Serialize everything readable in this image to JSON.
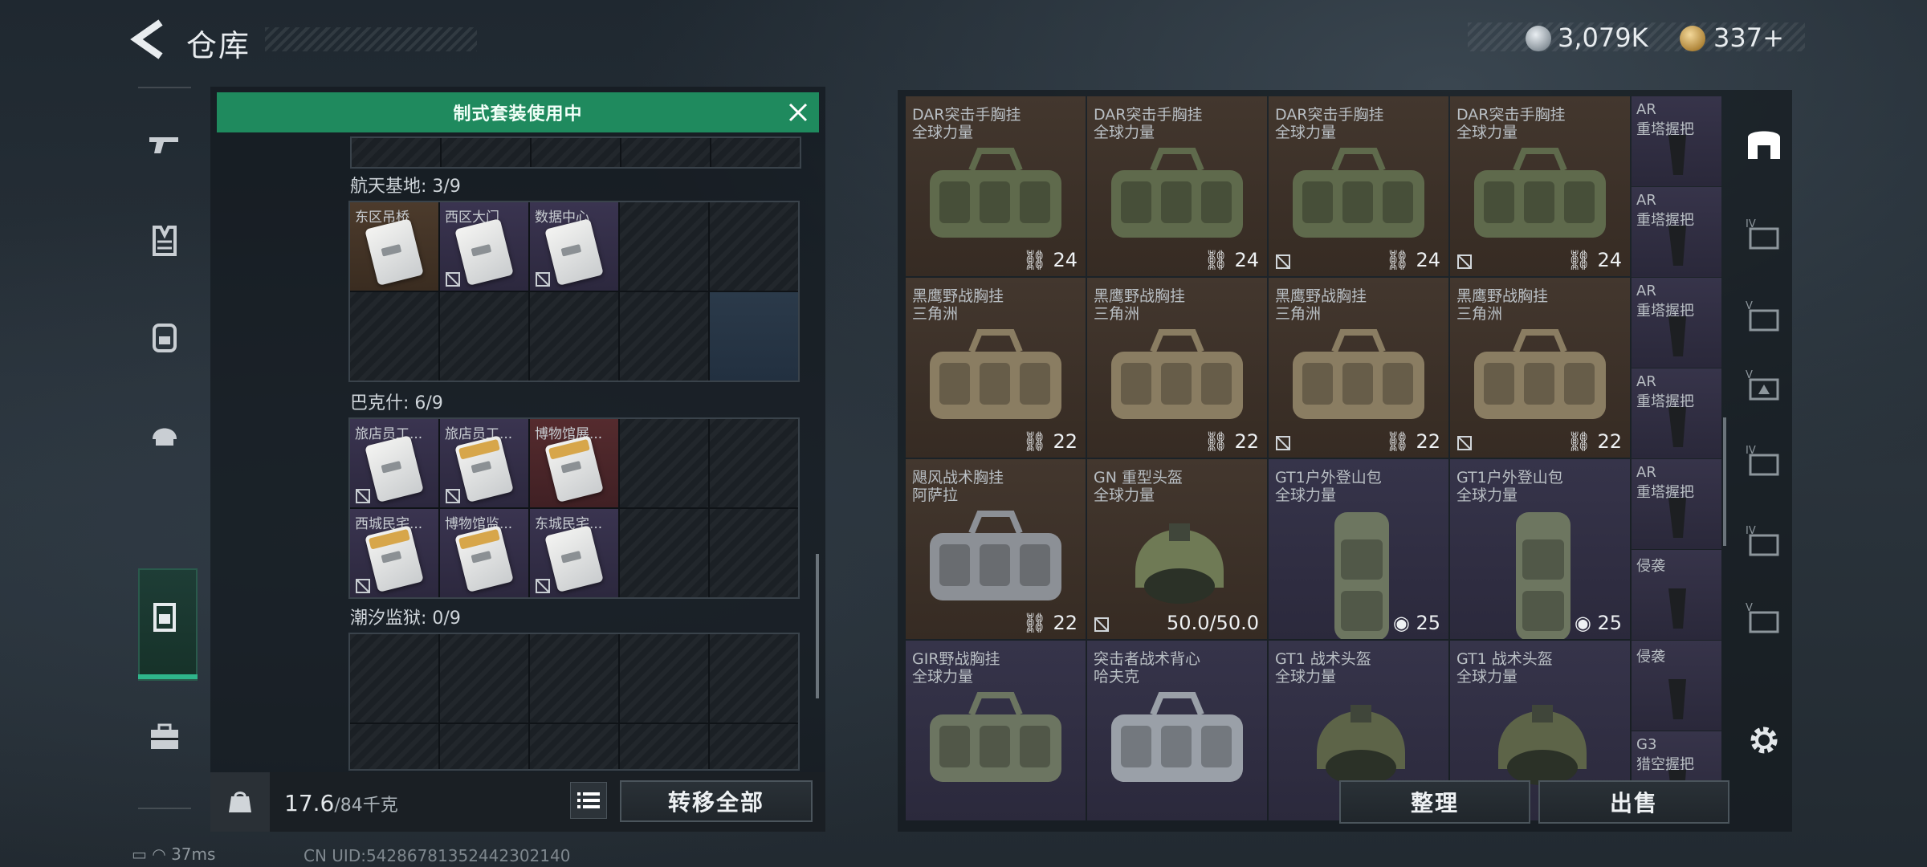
{
  "header": {
    "title": "仓库",
    "currency_silver": "3,079K",
    "currency_gold": "337+"
  },
  "banner": {
    "text": "制式套装使用中"
  },
  "sections": [
    {
      "label": "航天基地: 3/9",
      "cells": [
        "东区吊桥",
        "西区大门",
        "数据中心"
      ]
    },
    {
      "label": "巴克什: 6/9",
      "cells": [
        "旅店员工...",
        "旅店员工...",
        "博物馆展...",
        "西城民宅...",
        "博物馆监...",
        "东城民宅..."
      ]
    },
    {
      "label": "潮汐监狱: 0/9",
      "cells": []
    }
  ],
  "footer": {
    "weight": "17.6",
    "capacity": "/84千克",
    "transfer_all": "转移全部",
    "kg_label": "KG"
  },
  "items": [
    {
      "name": "DAR突击手胸挂",
      "brand": "全球力量",
      "value": "24",
      "color": "brown",
      "kind": "bag",
      "bagcolor": "#5f6a4c"
    },
    {
      "name": "DAR突击手胸挂",
      "brand": "全球力量",
      "value": "24",
      "color": "brown",
      "kind": "bag",
      "bagcolor": "#5f6a4c"
    },
    {
      "name": "DAR突击手胸挂",
      "brand": "全球力量",
      "value": "24",
      "color": "brown",
      "kind": "bag",
      "bagcolor": "#5f6a4c"
    },
    {
      "name": "DAR突击手胸挂",
      "brand": "全球力量",
      "value": "24",
      "color": "brown",
      "kind": "bag",
      "bagcolor": "#5f6a4c"
    },
    {
      "name": "黑鹰野战胸挂",
      "brand": "三角洲",
      "value": "22",
      "color": "brown",
      "kind": "bag",
      "bagcolor": "#8a7d62"
    },
    {
      "name": "黑鹰野战胸挂",
      "brand": "三角洲",
      "value": "22",
      "color": "brown",
      "kind": "bag",
      "bagcolor": "#8a7d62"
    },
    {
      "name": "黑鹰野战胸挂",
      "brand": "三角洲",
      "value": "22",
      "color": "brown",
      "kind": "bag",
      "bagcolor": "#8a7d62"
    },
    {
      "name": "黑鹰野战胸挂",
      "brand": "三角洲",
      "value": "22",
      "color": "brown",
      "kind": "bag",
      "bagcolor": "#8a7d62"
    },
    {
      "name": "飓风战术胸挂",
      "brand": "阿萨拉",
      "value": "22",
      "color": "brown",
      "kind": "bag",
      "bagcolor": "#8c9096"
    },
    {
      "name": "GN 重型头盔",
      "brand": "全球力量",
      "value": "50.0/50.0",
      "color": "brown",
      "kind": "helmet",
      "bagcolor": "#6f7a55"
    },
    {
      "name": "GT1户外登山包",
      "brand": "全球力量",
      "value": "25",
      "color": "purple",
      "kind": "pack",
      "bagcolor": "#6d7660"
    },
    {
      "name": "GT1户外登山包",
      "brand": "全球力量",
      "value": "25",
      "color": "purple",
      "kind": "pack",
      "bagcolor": "#6d7660"
    },
    {
      "name": "GIR野战胸挂",
      "brand": "全球力量",
      "value": "",
      "color": "purple",
      "kind": "bag",
      "bagcolor": "#6c7561"
    },
    {
      "name": "突击者战术背心",
      "brand": "哈夫克",
      "value": "",
      "color": "purple",
      "kind": "bag",
      "bagcolor": "#9aa0a8"
    },
    {
      "name": "GT1 战术头盔",
      "brand": "全球力量",
      "value": "",
      "color": "purple",
      "kind": "helmet",
      "bagcolor": "#5d6448"
    },
    {
      "name": "GT1 战术头盔",
      "brand": "全球力量",
      "value": "",
      "color": "purple",
      "kind": "helmet",
      "bagcolor": "#5d6448"
    }
  ],
  "side_items": [
    {
      "t1": "AR",
      "t2": "重塔握把"
    },
    {
      "t1": "AR",
      "t2": "重塔握把"
    },
    {
      "t1": "AR",
      "t2": "重塔握把"
    },
    {
      "t1": "AR",
      "t2": "重塔握把"
    },
    {
      "t1": "AR",
      "t2": "重塔握把"
    },
    {
      "t1": "侵袭",
      "t2": ""
    },
    {
      "t1": "侵袭",
      "t2": ""
    },
    {
      "t1": "G3",
      "t2": "猎空握把"
    }
  ],
  "actions": {
    "organize": "整理",
    "sell": "出售"
  },
  "status": {
    "ping": "37ms",
    "uid": "CN UID:5428678135244230214​0"
  }
}
